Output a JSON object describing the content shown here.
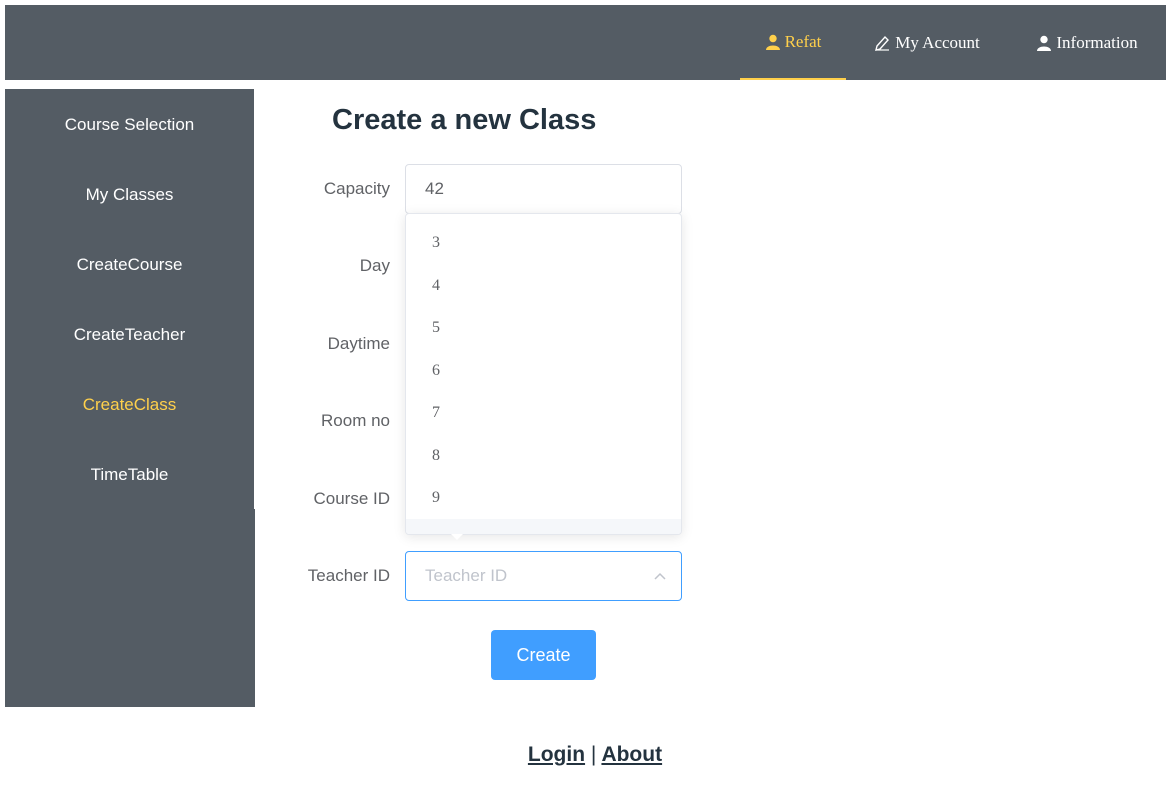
{
  "nav": {
    "items": [
      {
        "label": "Refat",
        "icon": "user-icon",
        "active": true
      },
      {
        "label": "My Account",
        "icon": "pencil-icon",
        "active": false
      },
      {
        "label": "Information",
        "icon": "user-icon",
        "active": false
      }
    ]
  },
  "sidebar": {
    "items": [
      {
        "label": "Course Selection"
      },
      {
        "label": "My Classes"
      },
      {
        "label": "CreateCourse"
      },
      {
        "label": "CreateTeacher"
      },
      {
        "label": "CreateClass",
        "active": true
      },
      {
        "label": "TimeTable"
      }
    ]
  },
  "form": {
    "title": "Create a new Class",
    "labels": {
      "capacity": "Capacity",
      "day": "Day",
      "daytime": "Daytime",
      "room": "Room no",
      "course": "Course ID",
      "teacher": "Teacher ID"
    },
    "capacity_value": "42",
    "teacher_placeholder": "Teacher ID",
    "dropdown_options": [
      "3",
      "4",
      "5",
      "6",
      "7",
      "8",
      "9"
    ],
    "create_label": "Create"
  },
  "footer": {
    "login": "Login",
    "separator": "|",
    "about": "About"
  },
  "colors": {
    "bar": "#545c64",
    "accent": "#ffd04b",
    "primary": "#409eff"
  }
}
